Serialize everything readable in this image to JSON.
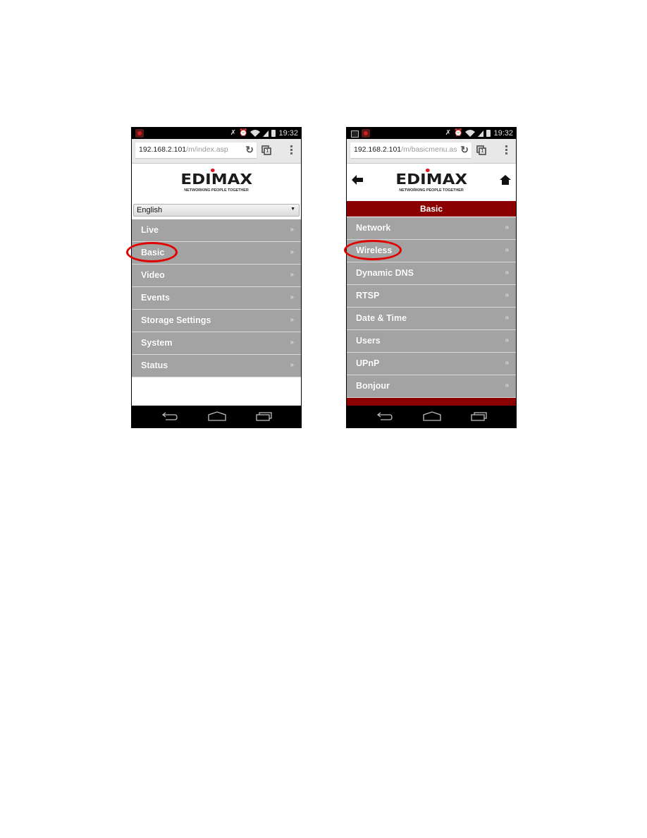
{
  "left_screen": {
    "status_bar": {
      "time": "19:32",
      "icons": [
        "app-notification-icon",
        "mute-icon",
        "alarm-icon",
        "wifi-icon",
        "signal-icon",
        "battery-icon"
      ]
    },
    "browser": {
      "url_host": "192.168.2.101",
      "url_path": "/m/index.asp",
      "tab_count": "1"
    },
    "logo": {
      "brand": "EDIMAX",
      "tagline": "NETWORKING PEOPLE TOGETHER"
    },
    "language_select": {
      "value": "English"
    },
    "menu_items": [
      {
        "label": "Live"
      },
      {
        "label": "Basic",
        "highlighted": true
      },
      {
        "label": "Video"
      },
      {
        "label": "Events"
      },
      {
        "label": "Storage Settings"
      },
      {
        "label": "System"
      },
      {
        "label": "Status"
      }
    ],
    "chevron": "»"
  },
  "right_screen": {
    "status_bar": {
      "time": "19:32",
      "icons": [
        "screenshot-icon",
        "app-notification-icon",
        "mute-icon",
        "alarm-icon",
        "wifi-icon",
        "signal-icon",
        "battery-icon"
      ]
    },
    "browser": {
      "url_host": "192.168.2.101",
      "url_path": "/m/basicmenu.as",
      "tab_count": "1"
    },
    "logo": {
      "brand": "EDIMAX",
      "tagline": "NETWORKING PEOPLE TOGETHER"
    },
    "section_title": "Basic",
    "menu_items": [
      {
        "label": "Network"
      },
      {
        "label": "Wireless",
        "highlighted": true
      },
      {
        "label": "Dynamic DNS"
      },
      {
        "label": "RTSP"
      },
      {
        "label": "Date & Time"
      },
      {
        "label": "Users"
      },
      {
        "label": "UPnP"
      },
      {
        "label": "Bonjour"
      }
    ],
    "chevron": "»"
  },
  "colors": {
    "menu_bg": "#a3a3a3",
    "section_bar": "#8b0000",
    "highlight": "#e00000",
    "brand_dot": "#e1141e"
  }
}
